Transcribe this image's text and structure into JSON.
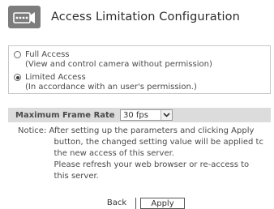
{
  "header": {
    "title": "Access Limitation Configuration",
    "icon": "camera-settings-icon"
  },
  "access_options": [
    {
      "label": "Full Access",
      "description": "(View and control camera without permission)",
      "selected": false
    },
    {
      "label": "Limited Access",
      "description": "(In accordance with an user's permission.)",
      "selected": true
    }
  ],
  "frame_rate": {
    "label": "Maximum Frame Rate",
    "value": "30 fps"
  },
  "notice": {
    "prefix": "Notice: ",
    "lines": [
      "After setting up the parameters and clicking Apply",
      "button, the changed setting value will be applied tc",
      "the new access of this server.",
      "Please refresh your web browser or re-access to",
      "this server."
    ]
  },
  "buttons": {
    "back": "Back",
    "apply": "Apply"
  }
}
